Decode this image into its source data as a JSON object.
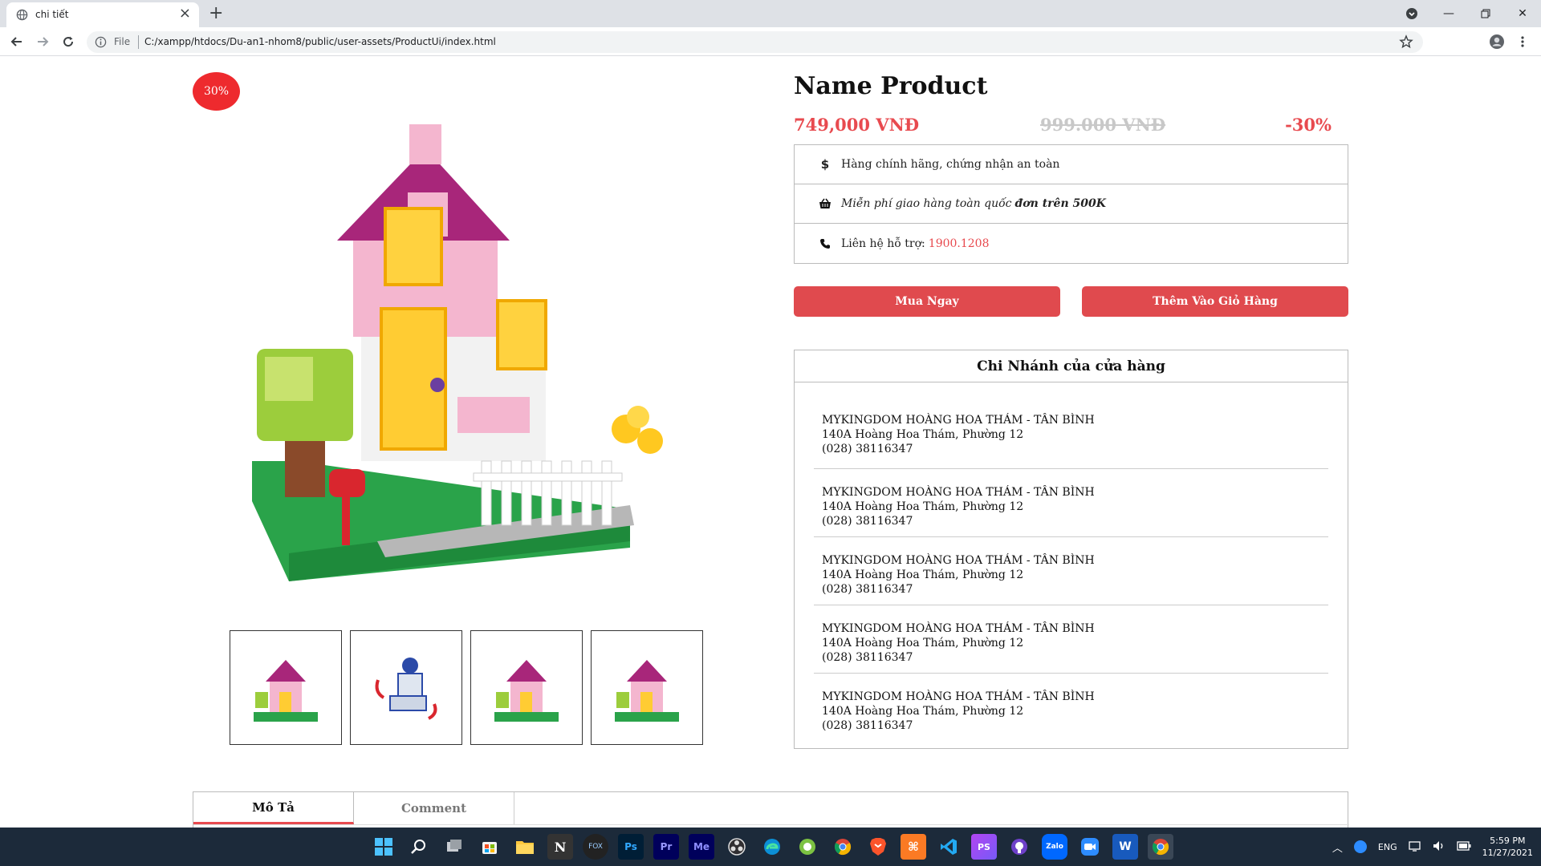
{
  "browser": {
    "tab_title": "chi tiết",
    "omnibox_scheme": "File",
    "url": "C:/xampp/htdocs/Du-an1-nhom8/public/user-assets/ProductUi/index.html"
  },
  "product": {
    "discount_badge": "30%",
    "name": "Name Product",
    "price_new": "749,000 VNĐ",
    "price_old": "999.000 VNĐ",
    "price_discount": "-30%"
  },
  "info": {
    "genuine": "Hàng chính hãng, chứng nhận an toàn",
    "shipping_prefix": "Miễn phí giao hàng toàn quốc ",
    "shipping_bold": "đơn trên 500K",
    "support_label": "Liên hệ hỗ trợ:",
    "support_phone": "1900.1208"
  },
  "buttons": {
    "buy_now": "Mua Ngay",
    "add_to_cart": "Thêm Vào Giỏ Hàng"
  },
  "branches": {
    "title": "Chi Nhánh của cửa hàng",
    "items": [
      {
        "name": "MYKINGDOM HOÀNG HOA THÁM - TÂN BÌNH",
        "address": "140A Hoàng Hoa Thám, Phường 12",
        "phone": "(028) 38116347"
      },
      {
        "name": "MYKINGDOM HOÀNG HOA THÁM - TÂN BÌNH",
        "address": "140A Hoàng Hoa Thám, Phường 12",
        "phone": "(028) 38116347"
      },
      {
        "name": "MYKINGDOM HOÀNG HOA THÁM - TÂN BÌNH",
        "address": "140A Hoàng Hoa Thám, Phường 12",
        "phone": "(028) 38116347"
      },
      {
        "name": "MYKINGDOM HOÀNG HOA THÁM - TÂN BÌNH",
        "address": "140A Hoàng Hoa Thám, Phường 12",
        "phone": "(028) 38116347"
      },
      {
        "name": "MYKINGDOM HOÀNG HOA THÁM - TÂN BÌNH",
        "address": "140A Hoàng Hoa Thám, Phường 12",
        "phone": "(028) 38116347"
      }
    ]
  },
  "page_tabs": {
    "description": "Mô Tả",
    "comment": "Comment"
  },
  "taskbar": {
    "language": "ENG",
    "time": "5:59 PM",
    "date": "11/27/2021"
  },
  "colors": {
    "accent": "#e84a4f",
    "badge": "#ee2a2e",
    "button": "#e04a4e",
    "taskbar": "#1c2a3a"
  }
}
